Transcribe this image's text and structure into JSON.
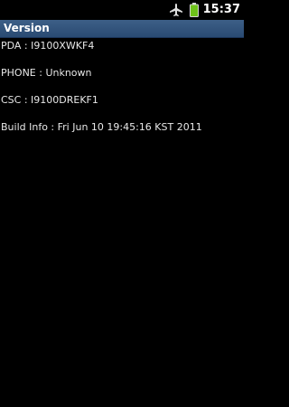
{
  "status_bar": {
    "time": "15:37",
    "icons": [
      "airplane-mode-icon",
      "battery-icon"
    ],
    "battery_color": "#6ec21a"
  },
  "title_bar": {
    "title": "Version",
    "bg_color": "#2f5079"
  },
  "info": {
    "pda": "PDA : I9100XWKF4",
    "phone": "PHONE : Unknown",
    "csc": "CSC : I9100DREKF1",
    "build_info": "Build Info : Fri Jun 10 19:45:16 KST 2011"
  }
}
